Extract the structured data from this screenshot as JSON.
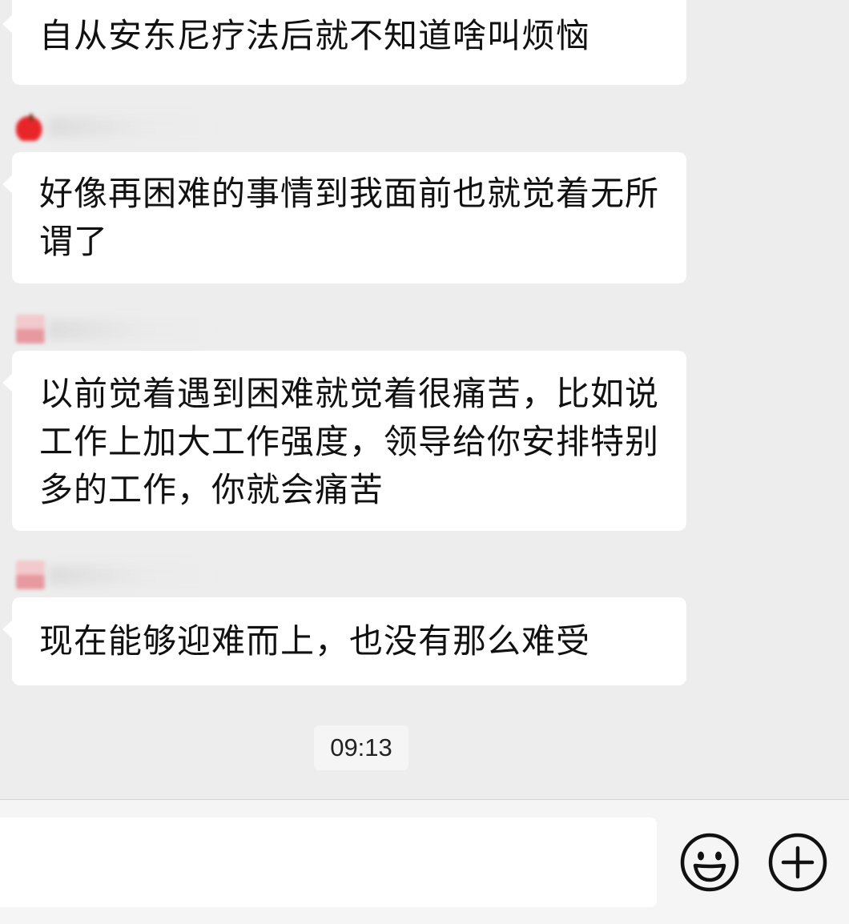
{
  "messages": [
    {
      "text": "自从安东尼疗法后就不知道啥叫烦恼"
    },
    {
      "text": "好像再困难的事情到我面前也就觉着无所谓了"
    },
    {
      "text": "以前觉着遇到困难就觉着很痛苦，比如说工作上加大工作强度，领导给你安排特别多的工作，你就会痛苦"
    },
    {
      "text": "现在能够迎难而上，也没有那么难受"
    }
  ],
  "timestamp": "09:13",
  "input_bar": {
    "message_value": "",
    "emoji_icon": "smiley-face-icon",
    "plus_icon": "plus-circle-icon"
  }
}
